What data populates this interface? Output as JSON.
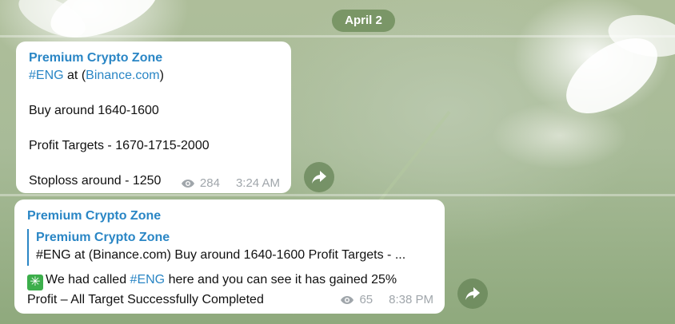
{
  "date_separator": "April 2",
  "messages": [
    {
      "author": "Premium Crypto Zone",
      "hashtag": "#ENG",
      "at_text": " at (",
      "link": "Binance.com",
      "close_paren": ")",
      "line_buy": "Buy around 1640-1600",
      "line_targets": "Profit Targets - 1670-1715-2000",
      "line_stop": "Stoploss around - 1250",
      "views": "284",
      "time": "3:24 AM"
    },
    {
      "author": "Premium Crypto Zone",
      "reply_author": "Premium Crypto Zone",
      "reply_text": "#ENG at (Binance.com)  Buy around 1640-1600  Profit Targets - ...",
      "check_glyph": "✳",
      "text_before": "We had called ",
      "hashtag": "#ENG",
      "text_after": " here and you can see it has gained 25%",
      "text_line2": "Profit – All Target Successfully Completed",
      "views": "65",
      "time": "8:38 PM"
    }
  ],
  "icons": {
    "views": "eye-icon",
    "share": "share-arrow-icon"
  },
  "colors": {
    "link": "#2a86c5",
    "meta": "#a0a6ab",
    "date_pill": "#6e8c5a"
  }
}
